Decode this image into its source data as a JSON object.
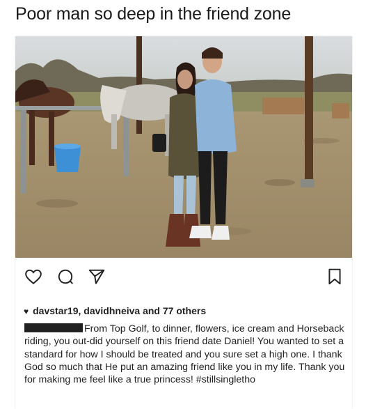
{
  "meme": {
    "title": "Poor man so deep in the friend zone"
  },
  "post": {
    "likes": {
      "users": "davstar19, davidhneiva",
      "connector": " and ",
      "others": "77 others"
    },
    "caption": {
      "author": "[redacted]",
      "text": "From Top Golf, to dinner, flowers, ice cream and Horseback riding, you out-did yourself on this friend date Daniel! You wanted to set a standard for how I should be treated and you sure set a high one. I thank God so much that He put an amazing friend like you in my life. Thank you for making me feel like a true princess! #stillsingletho"
    },
    "icons": {
      "like": "heart-outline-icon",
      "comment": "comment-icon",
      "share": "send-icon",
      "save": "bookmark-icon",
      "liked_by": "heart-filled-icon"
    }
  }
}
